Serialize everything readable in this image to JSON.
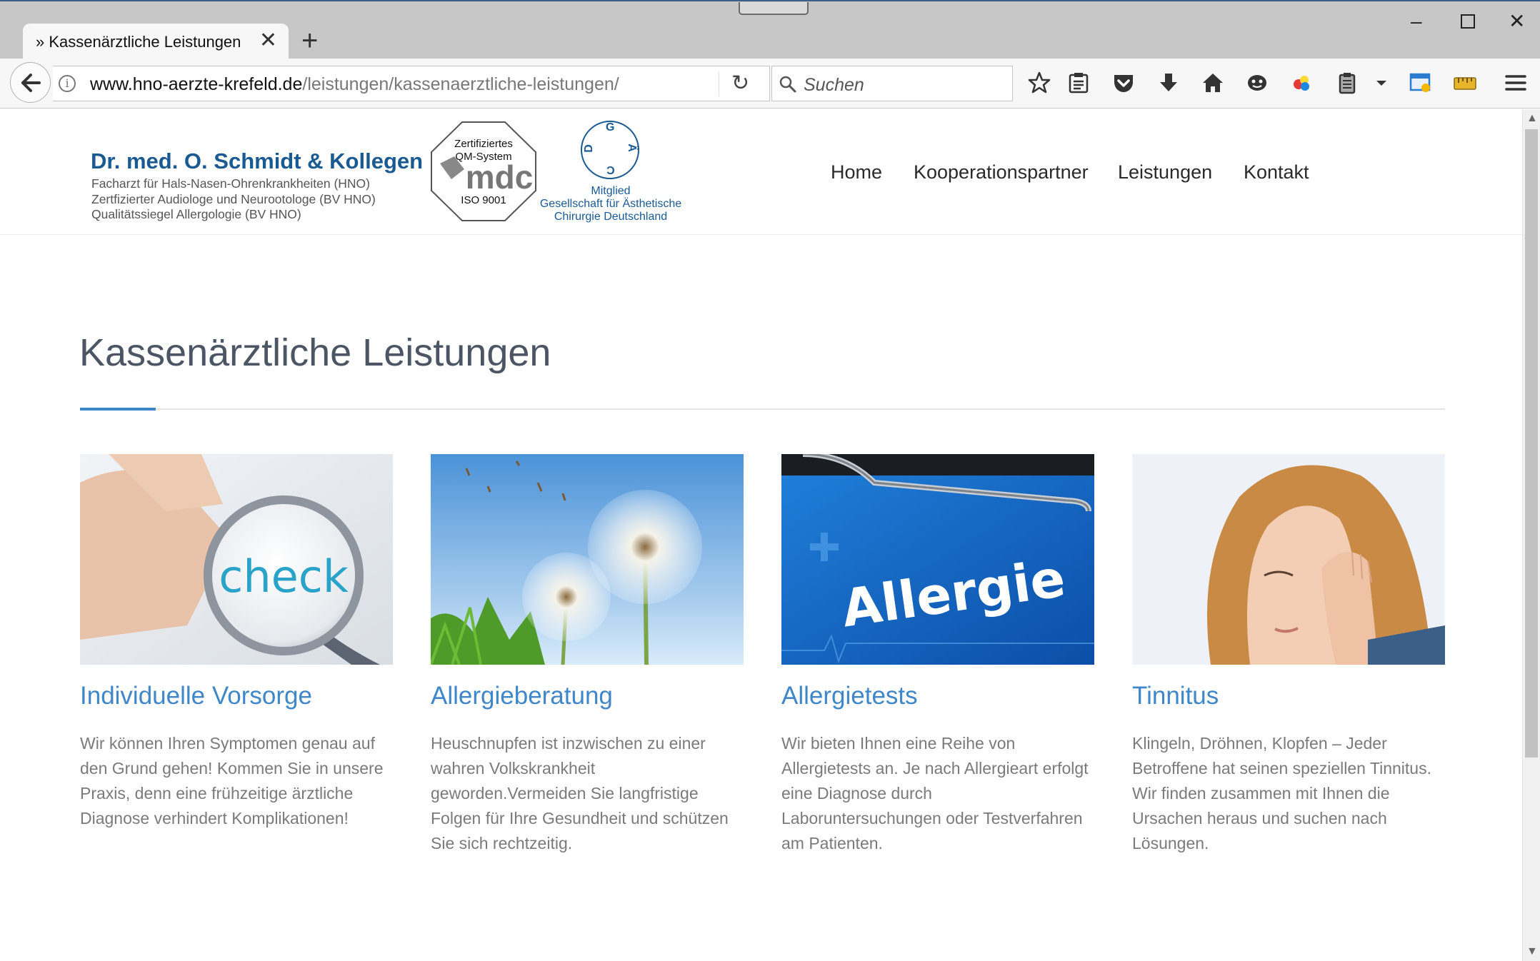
{
  "browser": {
    "tab_title": "» Kassenärztliche Leistungen",
    "url_host": "www.hno-aerzte-krefeld.de",
    "url_path": "/leistungen/kassenaerztliche-leistungen/",
    "search_placeholder": "Suchen",
    "toolbar_icons": [
      "bookmark-star-icon",
      "reading-list-icon",
      "pocket-icon",
      "download-icon",
      "home-icon",
      "emoji-icon",
      "colorful-addon-icon",
      "clipboard-icon",
      "dropdown-arrow-icon",
      "window-addon-icon",
      "ruler-addon-icon",
      "menu-icon"
    ]
  },
  "site": {
    "logo": {
      "name": "Dr. med. O. Schmidt & Kollegen",
      "lines": [
        "Facharzt für Hals-Nasen-Ohrenkrankheiten (HNO)",
        "Zertfizierter Audiologe und Neurootologe (BV HNO)",
        "Qualitätssiegel Allergologie (BV HNO)"
      ]
    },
    "seal": {
      "top1": "Zertifiziertes",
      "top2": "QM-System",
      "brand": "mdc",
      "bottom": "ISO 9001"
    },
    "member": {
      "letters": [
        "G",
        "Ä",
        "C",
        "D"
      ],
      "lines": [
        "Mitglied",
        "Gesellschaft für Ästhetische",
        "Chirurgie Deutschland"
      ]
    },
    "nav": [
      "Home",
      "Kooperationspartner",
      "Leistungen",
      "Kontakt"
    ]
  },
  "page": {
    "title": "Kassenärztliche Leistungen",
    "cards": [
      {
        "title": "Individuelle Vorsorge",
        "text": "Wir können Ihren Symptomen genau auf den Grund gehen! Kommen Sie in unsere Praxis, denn eine frühzeitige ärztliche Diagnose verhindert Komplikationen!",
        "image_word": "check"
      },
      {
        "title": "Allergieberatung",
        "text": "Heuschnupfen ist inzwischen zu einer wahren Volkskrankheit geworden.Vermeiden Sie langfristige Folgen für Ihre Gesundheit und schützen Sie sich rechtzeitig."
      },
      {
        "title": "Allergietests",
        "text": "Wir bieten Ihnen eine Reihe von Allergietests an. Je nach Allergieart erfolgt eine Diagnose durch Laboruntersuchungen oder Testverfahren am Patienten.",
        "image_word": "Allergie"
      },
      {
        "title": "Tinnitus",
        "text": "Klingeln, Dröhnen, Klopfen – Jeder Betroffene hat seinen speziellen Tinnitus. Wir finden zusammen mit Ihnen die Ursachen heraus und suchen nach Lösungen."
      }
    ]
  },
  "colors": {
    "brand": "#1a5a93",
    "accent": "#3f87c8",
    "heading": "#4b5563",
    "body_text": "#7a7a7a"
  }
}
